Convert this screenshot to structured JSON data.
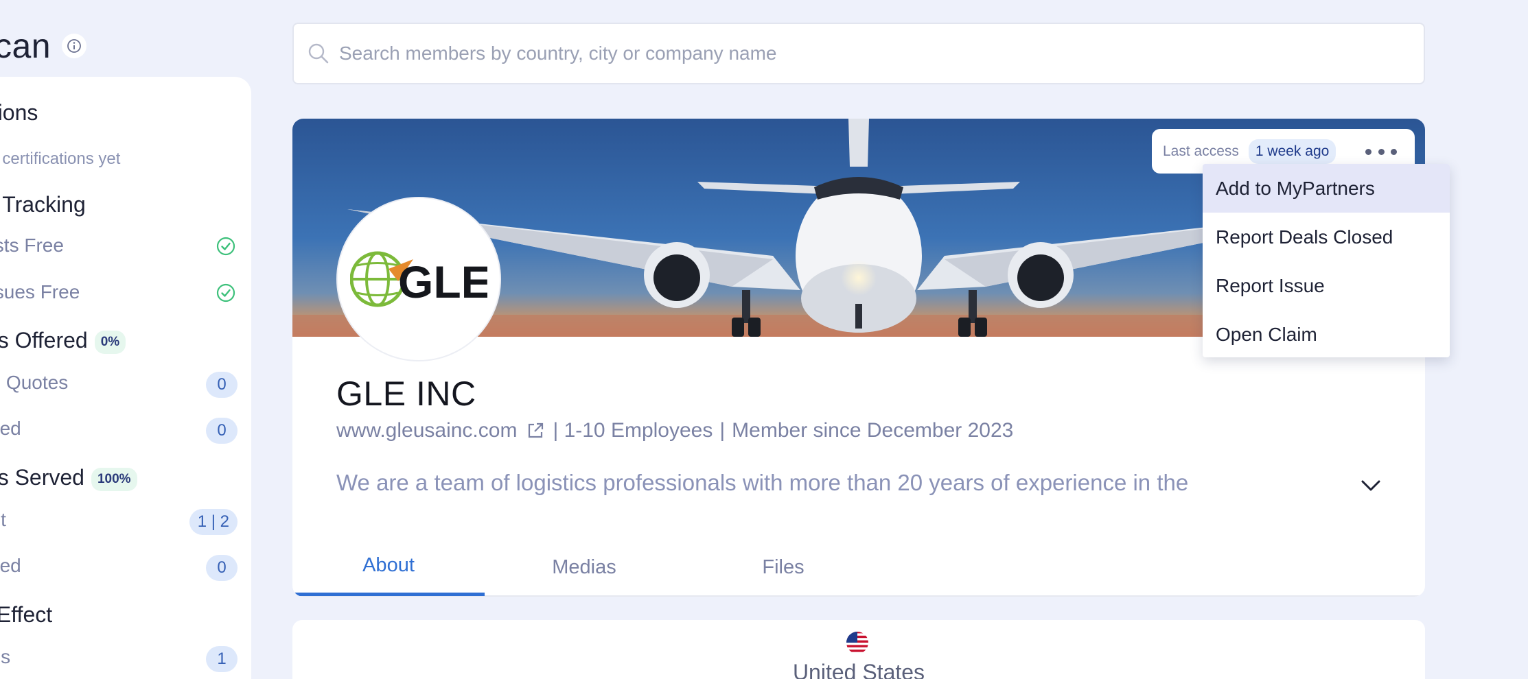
{
  "left_panel": {
    "title": "can",
    "sections": [
      {
        "heading": "ations",
        "note": "ed certifications yet"
      },
      {
        "heading": "al Tracking",
        "rows": [
          {
            "label": "Lists Free",
            "status": "check"
          },
          {
            "label": "Issues Free",
            "status": "check"
          }
        ]
      },
      {
        "heading": "nts Offered",
        "percent": "0%",
        "rows": [
          {
            "label": "ed Quotes",
            "count": "0"
          },
          {
            "label": "osed",
            "count": "0"
          }
        ]
      },
      {
        "heading": "nts Served",
        "percent": "100%",
        "rows": [
          {
            "label": "ent",
            "count": "1 | 2"
          },
          {
            "label": "osed",
            "count": "0"
          }
        ]
      },
      {
        "heading": "k Effect",
        "rows": [
          {
            "label": "ons",
            "count": "1"
          }
        ]
      }
    ]
  },
  "search": {
    "placeholder": "Search members by country, city or company name"
  },
  "profile": {
    "last_access_label": "Last access",
    "last_access_value": "1 week ago",
    "logo_text": "GLE",
    "company_name": "GLE INC",
    "website": "www.gleusainc.com",
    "employees": "| 1-10 Employees",
    "separator": "|",
    "member_since": "Member since December 2023",
    "description": "We are a team of logistics professionals with more than 20 years of experience in the",
    "tabs": [
      "About",
      "Medias",
      "Files"
    ],
    "active_tab": "About"
  },
  "dropdown_menu": {
    "items": [
      "Add to MyPartners",
      "Report Deals Closed",
      "Report Issue",
      "Open Claim"
    ],
    "hovered": "Add to MyPartners"
  },
  "location": {
    "country": "United States"
  },
  "colors": {
    "background": "#eef1fb",
    "accent": "#2f6fd3",
    "badge_bg": "#dde8fb",
    "success": "#3cc07a"
  }
}
